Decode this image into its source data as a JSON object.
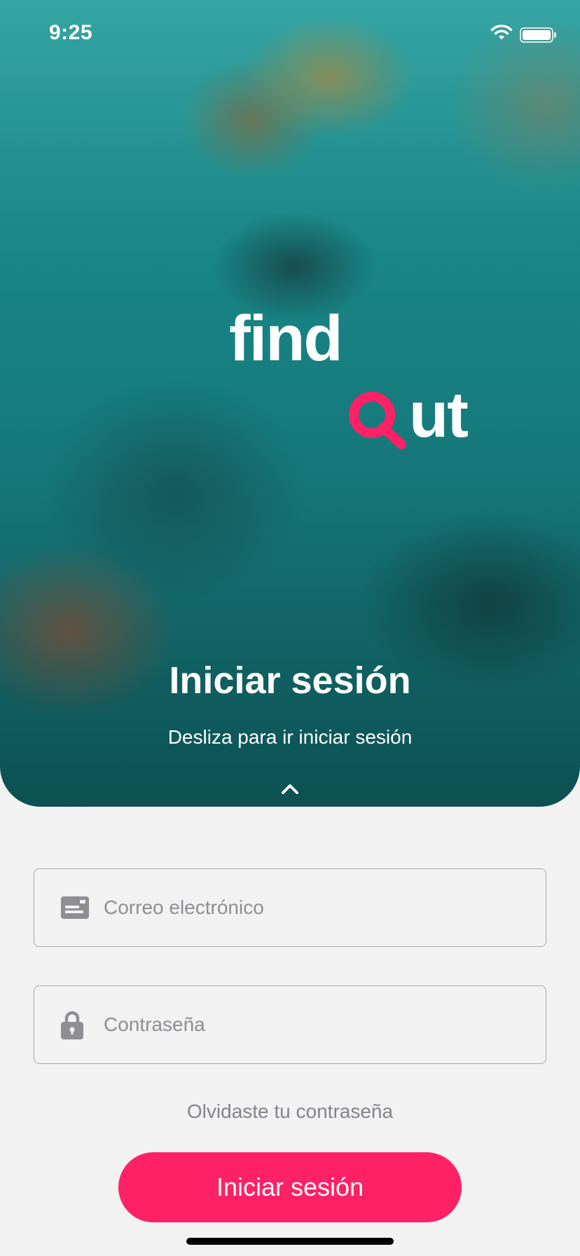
{
  "status_bar": {
    "time": "9:25"
  },
  "logo": {
    "word_top": "find",
    "word_bottom_rest": "ut",
    "accent_color": "#ff2166"
  },
  "hero": {
    "title": "Iniciar sesión",
    "subtitle": "Desliza para ir iniciar sesión"
  },
  "form": {
    "email": {
      "placeholder": "Correo electrónico",
      "value": "",
      "icon": "id-card-icon"
    },
    "password": {
      "placeholder": "Contraseña",
      "value": "",
      "icon": "lock-icon"
    },
    "forgot_label": "Olvidaste tu contraseña",
    "submit_label": "Iniciar sesión"
  },
  "colors": {
    "primary": "#ff2166",
    "background": "#f2f2f2",
    "muted_text": "#83838b"
  }
}
